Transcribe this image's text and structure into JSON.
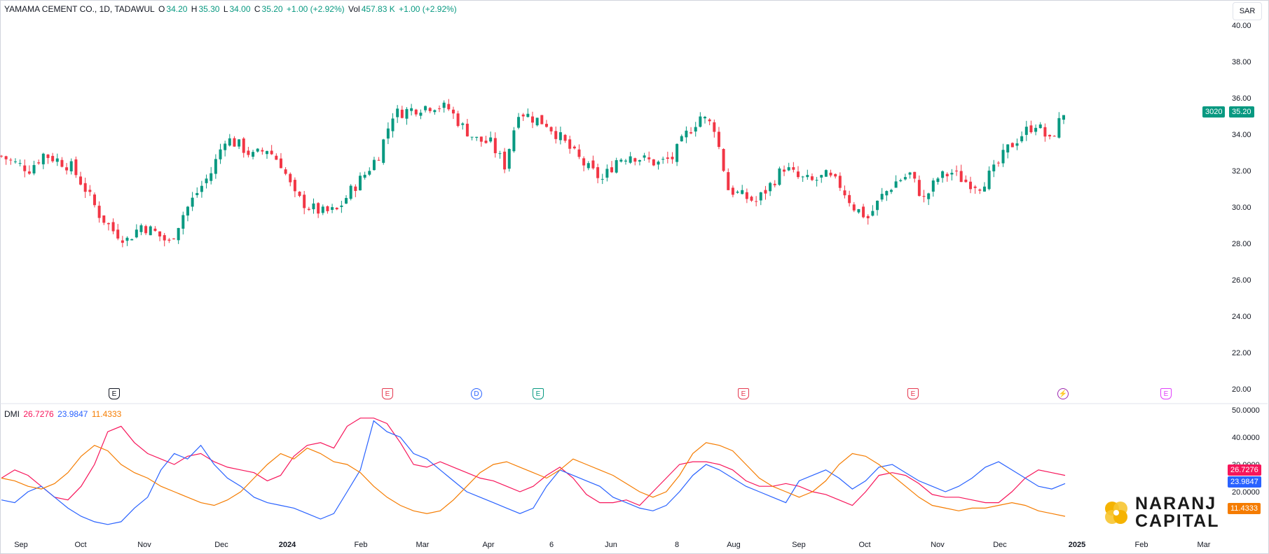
{
  "legend": {
    "title": "YAMAMA CEMENT CO., 1D, TADAWUL",
    "o_label": "O",
    "o_value": "34.20",
    "h_label": "H",
    "h_value": "35.30",
    "l_label": "L",
    "l_value": "34.00",
    "c_label": "C",
    "c_value": "35.20",
    "change": "+1.00 (+2.92%)",
    "vol_label": "Vol",
    "vol_value": "457.83 K",
    "vol_change": "+1.00 (+2.92%)"
  },
  "currency": "SAR",
  "price_tags": {
    "symbol": "3020",
    "last": "35.20"
  },
  "dmi_legend": {
    "name": "DMI",
    "v1": "26.7276",
    "v2": "23.9847",
    "v3": "11.4333"
  },
  "dmi_tags": [
    "26.7276",
    "23.9847",
    "11.4333"
  ],
  "events": [
    {
      "label": "E",
      "type": "shield",
      "color": "#131722"
    },
    {
      "label": "E",
      "type": "shield",
      "color": "#e53950"
    },
    {
      "label": "D",
      "type": "circle",
      "color": "#2962ff"
    },
    {
      "label": "E",
      "type": "shield",
      "color": "#089981"
    },
    {
      "label": "E",
      "type": "shield",
      "color": "#e53950"
    },
    {
      "label": "E",
      "type": "shield",
      "color": "#e53950"
    },
    {
      "label": "⚡",
      "type": "circle",
      "color": "#9c27b0"
    },
    {
      "label": "E",
      "type": "shield",
      "color": "#e040fb"
    }
  ],
  "logo": {
    "line1": "NARANJ",
    "line2": "CAPITAL"
  },
  "colors": {
    "up": "#089981",
    "down": "#f23645",
    "adx": "#f7165b",
    "plus_di": "#2962ff",
    "minus_di": "#f57c00"
  },
  "chart_data": [
    {
      "type": "candlestick",
      "title": "YAMAMA CEMENT CO., 1D, TADAWUL",
      "ylim": [
        20,
        40
      ],
      "y_ticks": [
        "40.00",
        "38.00",
        "36.00",
        "34.00",
        "32.00",
        "30.00",
        "28.00",
        "26.00",
        "24.00",
        "22.00",
        "20.00"
      ],
      "x_ticks": [
        "Sep",
        "Oct",
        "Nov",
        "Dec",
        "2024",
        "Feb",
        "Mar",
        "Apr",
        "6",
        "Jun",
        "8",
        "Aug",
        "Sep",
        "Oct",
        "Nov",
        "Dec",
        "2025",
        "Feb",
        "Mar"
      ],
      "close_path": [
        [
          0,
          32.8
        ],
        [
          3,
          32.4
        ],
        [
          6,
          32.1
        ],
        [
          9,
          32.9
        ],
        [
          12,
          32.6
        ],
        [
          15,
          32.2
        ],
        [
          18,
          31.0
        ],
        [
          21,
          29.6
        ],
        [
          24,
          28.7
        ],
        [
          27,
          28.2
        ],
        [
          30,
          29.0
        ],
        [
          33,
          28.6
        ],
        [
          36,
          28.0
        ],
        [
          39,
          29.6
        ],
        [
          42,
          30.8
        ],
        [
          45,
          31.9
        ],
        [
          48,
          33.8
        ],
        [
          51,
          33.4
        ],
        [
          54,
          32.8
        ],
        [
          57,
          33.2
        ],
        [
          60,
          32.4
        ],
        [
          63,
          30.6
        ],
        [
          66,
          30.0
        ],
        [
          69,
          29.7
        ],
        [
          72,
          29.8
        ],
        [
          75,
          30.9
        ],
        [
          78,
          31.8
        ],
        [
          81,
          32.9
        ],
        [
          84,
          35.1
        ],
        [
          87,
          35.3
        ],
        [
          90,
          35.5
        ],
        [
          93,
          35.6
        ],
        [
          96,
          35.4
        ],
        [
          99,
          34.4
        ],
        [
          102,
          33.7
        ],
        [
          105,
          33.5
        ],
        [
          108,
          32.3
        ],
        [
          111,
          35.3
        ],
        [
          114,
          34.9
        ],
        [
          117,
          34.6
        ],
        [
          120,
          33.8
        ],
        [
          123,
          32.9
        ],
        [
          126,
          32.1
        ],
        [
          129,
          31.5
        ],
        [
          132,
          32.6
        ],
        [
          135,
          32.9
        ],
        [
          138,
          32.6
        ],
        [
          141,
          32.4
        ],
        [
          144,
          32.7
        ],
        [
          147,
          34.0
        ],
        [
          150,
          35.0
        ],
        [
          153,
          34.4
        ],
        [
          156,
          31.0
        ],
        [
          159,
          30.6
        ],
        [
          162,
          30.3
        ],
        [
          165,
          31.2
        ],
        [
          168,
          32.2
        ],
        [
          171,
          31.6
        ],
        [
          174,
          31.4
        ],
        [
          177,
          31.7
        ],
        [
          180,
          31.2
        ],
        [
          183,
          30.0
        ],
        [
          186,
          29.4
        ],
        [
          189,
          30.6
        ],
        [
          192,
          31.4
        ],
        [
          195,
          31.8
        ],
        [
          198,
          30.4
        ],
        [
          201,
          31.6
        ],
        [
          204,
          31.9
        ],
        [
          207,
          31.4
        ],
        [
          210,
          31.2
        ],
        [
          213,
          32.0
        ],
        [
          216,
          33.2
        ],
        [
          219,
          34.0
        ],
        [
          222,
          34.6
        ],
        [
          225,
          33.6
        ],
        [
          228,
          35.2
        ]
      ]
    },
    {
      "type": "line",
      "title": "DMI",
      "ylim": [
        0,
        50
      ],
      "y_ticks": [
        "50.0000",
        "40.0000",
        "30.0000",
        "20.0000",
        "10.0000"
      ],
      "series": [
        {
          "name": "",
          "color": "#f7165b",
          "values": [
            25,
            28,
            26,
            22,
            18,
            17,
            22,
            30,
            42,
            44,
            38,
            34,
            32,
            30,
            33,
            34,
            31,
            29,
            28,
            27,
            24,
            26,
            33,
            37,
            38,
            36,
            44,
            47,
            47,
            45,
            38,
            30,
            29,
            31,
            29,
            27,
            25,
            24,
            22,
            20,
            22,
            26,
            29,
            25,
            19,
            16,
            16,
            17,
            15,
            20,
            25,
            30,
            31,
            31,
            30,
            28,
            24,
            22,
            22,
            23,
            22,
            20,
            19,
            17,
            15,
            20,
            26,
            27,
            26,
            23,
            19,
            18,
            18,
            17,
            16,
            16,
            20,
            25,
            28,
            27,
            26
          ]
        },
        {
          "name": "",
          "color": "#2962ff",
          "values": [
            17,
            16,
            20,
            22,
            18,
            14,
            11,
            9,
            8,
            9,
            14,
            18,
            28,
            34,
            32,
            37,
            30,
            25,
            22,
            18,
            16,
            15,
            14,
            12,
            10,
            12,
            20,
            28,
            46,
            42,
            40,
            34,
            32,
            28,
            24,
            20,
            18,
            16,
            14,
            12,
            14,
            22,
            28,
            26,
            24,
            22,
            18,
            16,
            14,
            13,
            15,
            20,
            26,
            30,
            28,
            25,
            22,
            20,
            18,
            16,
            24,
            26,
            28,
            25,
            21,
            24,
            29,
            30,
            27,
            24,
            22,
            20,
            22,
            25,
            29,
            31,
            28,
            25,
            22,
            21,
            23
          ]
        },
        {
          "name": "",
          "color": "#f57c00",
          "values": [
            25,
            24,
            22,
            21,
            23,
            27,
            33,
            37,
            35,
            30,
            27,
            25,
            22,
            20,
            18,
            16,
            15,
            17,
            20,
            25,
            30,
            34,
            32,
            36,
            34,
            31,
            30,
            27,
            22,
            18,
            15,
            13,
            12,
            13,
            17,
            22,
            27,
            30,
            31,
            29,
            27,
            25,
            28,
            32,
            30,
            28,
            26,
            23,
            20,
            18,
            20,
            26,
            34,
            38,
            37,
            35,
            30,
            25,
            22,
            20,
            18,
            20,
            24,
            30,
            34,
            33,
            30,
            26,
            22,
            18,
            15,
            14,
            13,
            14,
            14,
            15,
            16,
            15,
            13,
            12,
            11
          ]
        }
      ]
    }
  ]
}
